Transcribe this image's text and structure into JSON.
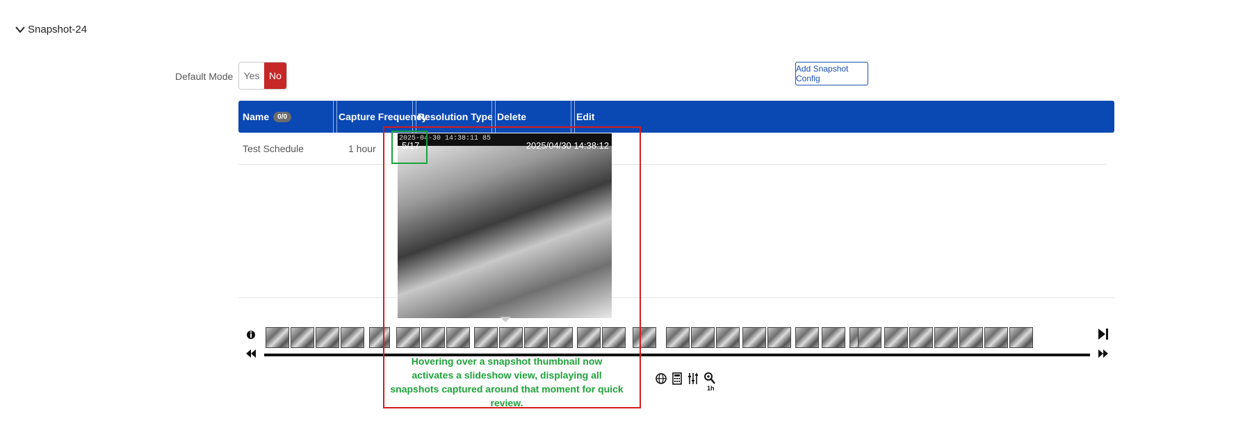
{
  "section": {
    "title": "Snapshot-24",
    "expand_icon": "chevron-down-icon"
  },
  "default_mode": {
    "label": "Default Mode",
    "options": [
      "Yes",
      "No"
    ],
    "selected": "No",
    "selected_color": "#c62828"
  },
  "toolbar": {
    "add_label": "Add Snapshot Config"
  },
  "table": {
    "header_color": "#0a48b3",
    "columns": {
      "name": "Name",
      "count": "0/0",
      "capture": "Capture Frequency",
      "resolution": "Resolution Type",
      "delete": "Delete",
      "edit": "Edit"
    },
    "rows": [
      {
        "name": "Test Schedule",
        "capture": "1 hour"
      }
    ]
  },
  "popup": {
    "camera_timestamp": "2025-04-30 14:38:11 85",
    "counter": "5/17",
    "image_timestamp": "2025/04/30 14:38:12"
  },
  "timeline": {
    "icons": {
      "info": "info-icon",
      "play_end": "skip-to-end-icon",
      "rewind": "fast-rewind-icon",
      "forward": "fast-forward-icon"
    },
    "tools": [
      "globe-icon",
      "calculator-icon",
      "filter-icon",
      "zoom-icon"
    ],
    "zoom_label": "1h"
  },
  "annotation": {
    "text": "Hovering over a snapshot thumbnail now activates a slideshow view, displaying all snapshots captured around that moment for quick review.",
    "color": "#1ea33a"
  },
  "highlight_colors": {
    "outer": "#d71a1a",
    "counter": "#19a33a"
  }
}
